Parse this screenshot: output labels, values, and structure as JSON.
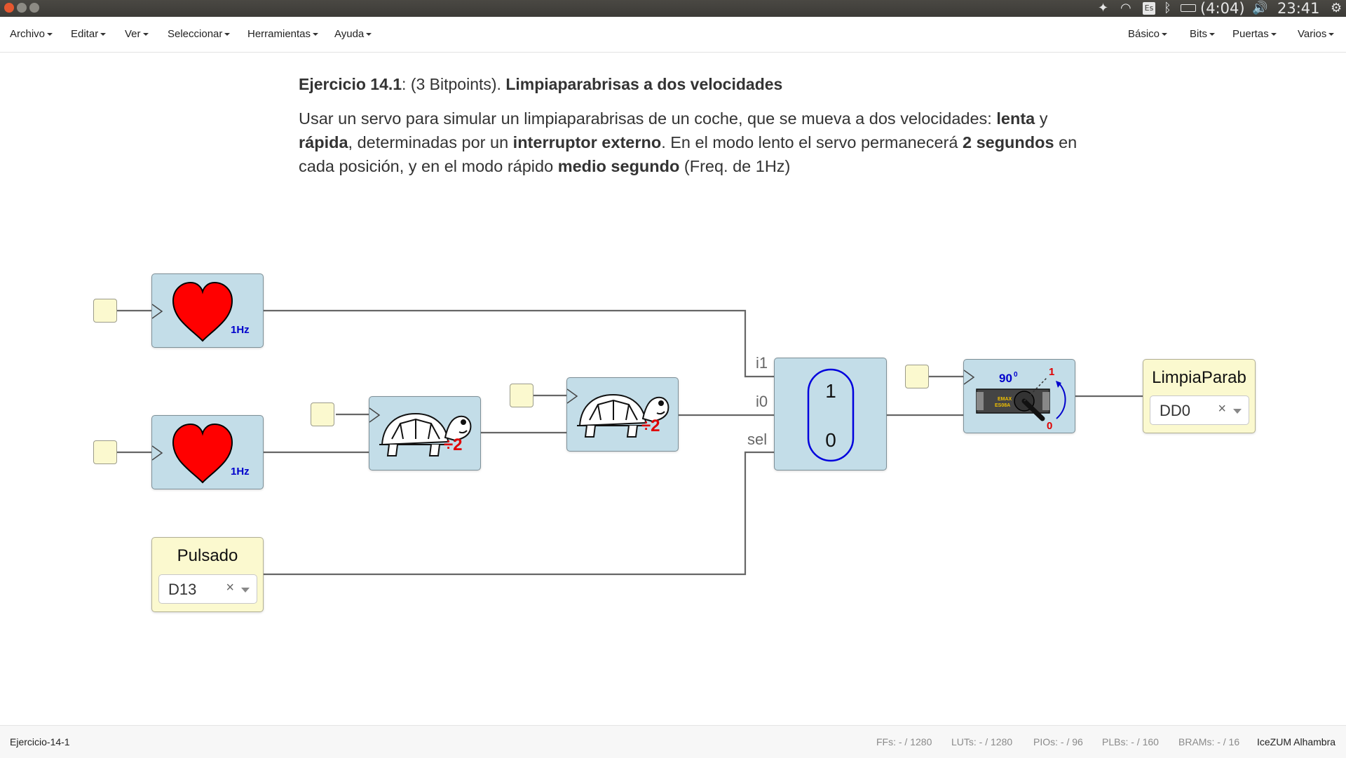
{
  "system_bar": {
    "time": "23:41",
    "battery": "(4:04)",
    "keyboard": "Es"
  },
  "menubar": {
    "left": [
      "Archivo",
      "Editar",
      "Ver",
      "Seleccionar",
      "Herramientas",
      "Ayuda"
    ],
    "right": [
      "Básico",
      "Bits",
      "Puertas",
      "Varios"
    ]
  },
  "description": {
    "title_prefix": "Ejercicio 14.1",
    "title_middle": ": (3 Bitpoints). ",
    "title_name": "Limpiaparabrisas a dos velocidades",
    "body": [
      {
        "t": "Usar un servo para simular un limpiaparabrisas de un coche, que se mueva a dos velocidades: ",
        "b": false
      },
      {
        "t": "lenta",
        "b": true
      },
      {
        "t": " y ",
        "b": false
      },
      {
        "t": "rápida",
        "b": true
      },
      {
        "t": ", determinadas por un ",
        "b": false
      },
      {
        "t": "interruptor externo",
        "b": true
      },
      {
        "t": ". En el modo lento el servo permanecerá ",
        "b": false
      },
      {
        "t": "2 segundos",
        "b": true
      },
      {
        "t": " en cada posición, y en el modo rápido ",
        "b": false
      },
      {
        "t": "medio segundo",
        "b": true
      },
      {
        "t": " (Freq. de 1Hz)",
        "b": false
      }
    ]
  },
  "circuit": {
    "heart1_label": "1Hz",
    "heart2_label": "1Hz",
    "divider1_label": "÷2",
    "divider2_label": "÷2",
    "mux_port_i1": "i1",
    "mux_port_i0": "i0",
    "mux_port_sel": "sel",
    "mux_value_1": "1",
    "mux_value_0": "0",
    "servo_angle": "90",
    "servo_angle_sup": "0",
    "servo_brand_1": "EMAX",
    "servo_brand_2": "ES08A",
    "servo_pos_1": "1",
    "servo_pos_0": "0",
    "input_label": "Pulsado",
    "input_pin": "D13",
    "output_label": "LimpiaParab",
    "output_pin": "DD0",
    "clear_glyph": "×"
  },
  "footer": {
    "filename": "Ejercicio-14-1",
    "ffs": "FFs:  - / 1280",
    "luts": "LUTs:  - / 1280",
    "pios": "PIOs:  - / 96",
    "plbs": "PLBs:  - / 160",
    "brams": "BRAMs:  - / 16",
    "board": "IceZUM Alhambra"
  },
  "colors": {
    "block_fill": "#c3dde8",
    "io_fill": "#fbf9cf",
    "heart": "#ff0000",
    "freq_label": "#0000cc",
    "divider_label": "#e00000",
    "wire": "#666666"
  }
}
